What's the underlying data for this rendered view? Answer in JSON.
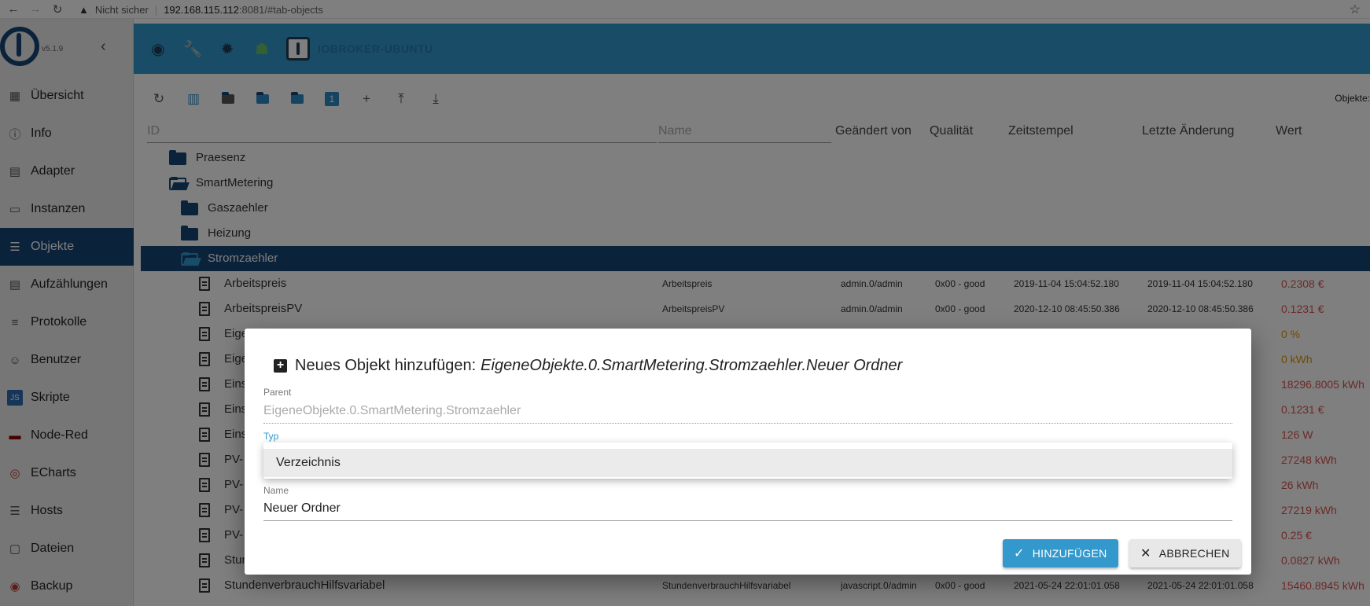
{
  "browser": {
    "insecure_label": "Nicht sicher",
    "url_host": "192.168.115.112",
    "url_rest": ":8081/#tab-objects"
  },
  "sidebar": {
    "version": "v5.1.9",
    "items": [
      {
        "label": "Übersicht",
        "icon": "grid-icon"
      },
      {
        "label": "Info",
        "icon": "info-icon"
      },
      {
        "label": "Adapter",
        "icon": "store-icon"
      },
      {
        "label": "Instanzen",
        "icon": "instances-icon"
      },
      {
        "label": "Objekte",
        "icon": "list-icon",
        "active": true
      },
      {
        "label": "Aufzählungen",
        "icon": "enum-icon"
      },
      {
        "label": "Protokolle",
        "icon": "log-icon"
      },
      {
        "label": "Benutzer",
        "icon": "user-icon"
      },
      {
        "label": "Skripte",
        "icon": "js-icon"
      },
      {
        "label": "Node-Red",
        "icon": "nodered-icon"
      },
      {
        "label": "ECharts",
        "icon": "echarts-icon"
      },
      {
        "label": "Hosts",
        "icon": "hosts-icon"
      },
      {
        "label": "Dateien",
        "icon": "files-icon"
      },
      {
        "label": "Backup",
        "icon": "backup-icon"
      }
    ]
  },
  "header": {
    "hostname": "IOBROKER-UBUNTU"
  },
  "toolbar": {
    "objects_label": "Objekte:"
  },
  "table": {
    "id_placeholder": "ID",
    "name_placeholder": "Name",
    "columns": {
      "changed_by": "Geändert von",
      "quality": "Qualität",
      "timestamp": "Zeitstempel",
      "last_change": "Letzte Änderung",
      "value": "Wert"
    },
    "rows": [
      {
        "type": "folder",
        "name": "Praesenz",
        "indent": 0
      },
      {
        "type": "folder-open",
        "name": "SmartMetering",
        "indent": 0
      },
      {
        "type": "folder",
        "name": "Gaszaehler",
        "indent": 1
      },
      {
        "type": "folder",
        "name": "Heizung",
        "indent": 1
      },
      {
        "type": "folder-open",
        "name": "Stromzaehler",
        "indent": 1,
        "selected": true
      },
      {
        "type": "state",
        "name": "Arbeitspreis",
        "title": "Arbeitspreis",
        "changed_by": "admin.0/admin",
        "quality": "0x00 - good",
        "ts": "2019-11-04 15:04:52.180",
        "lc": "2019-11-04 15:04:52.180",
        "value": "0.2308 €",
        "color": "red"
      },
      {
        "type": "state",
        "name": "ArbeitspreisPV",
        "title": "ArbeitspreisPV",
        "changed_by": "admin.0/admin",
        "quality": "0x00 - good",
        "ts": "2020-12-10 08:45:50.386",
        "lc": "2020-12-10 08:45:50.386",
        "value": "0.1231 €",
        "color": "red"
      },
      {
        "type": "state",
        "name": "Eige",
        "value": "0 %",
        "color": "orange"
      },
      {
        "type": "state",
        "name": "Eige",
        "value": "0 kWh",
        "color": "orange"
      },
      {
        "type": "state",
        "name": "Eins",
        "value": "18296.8005 kWh",
        "color": "red"
      },
      {
        "type": "state",
        "name": "Eins",
        "value": "0.1231 €",
        "color": "red"
      },
      {
        "type": "state",
        "name": "Eins",
        "value": "126 W",
        "color": "red"
      },
      {
        "type": "state",
        "name": "PV-",
        "value": "27248 kWh",
        "color": "red"
      },
      {
        "type": "state",
        "name": "PV-",
        "value": "26 kWh",
        "color": "red"
      },
      {
        "type": "state",
        "name": "PV-",
        "value": "27219 kWh",
        "color": "red"
      },
      {
        "type": "state",
        "name": "PV-",
        "value": "0.25 €",
        "color": "red"
      },
      {
        "type": "state",
        "name": "Stun",
        "value": "0.0827 kWh",
        "color": "red"
      },
      {
        "type": "state",
        "name": "StundenverbrauchHilfsvariabel",
        "title": "StundenverbrauchHilfsvariabel",
        "changed_by": "javascript.0/admin",
        "quality": "0x00 - good",
        "ts": "2021-05-24 22:01:01.058",
        "lc": "2021-05-24 22:01:01.058",
        "value": "15460.8945 kWh",
        "color": "red"
      }
    ]
  },
  "dialog": {
    "title_prefix": "Neues Objekt hinzufügen:",
    "title_path": "EigeneObjekte.0.SmartMetering.Stromzaehler.Neuer Ordner",
    "parent_label": "Parent",
    "parent_value": "EigeneObjekte.0.SmartMetering.Stromzaehler",
    "type_label": "Typ",
    "type_option": "Verzeichnis",
    "name_label": "Name",
    "name_value": "Neuer Ordner",
    "add_button": "HINZUFÜGEN",
    "cancel_button": "ABBRECHEN"
  }
}
